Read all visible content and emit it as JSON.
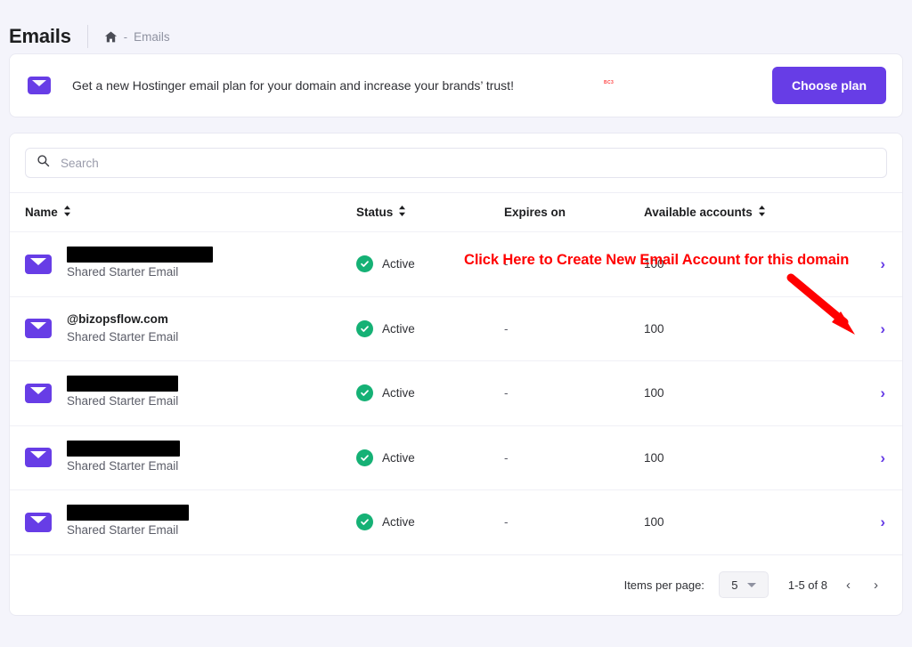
{
  "header": {
    "title": "Emails",
    "breadcrumb": {
      "home_icon": "home-icon",
      "separator": "-",
      "current": "Emails"
    }
  },
  "promo": {
    "icon": "envelope-icon",
    "text": "Get a new Hostinger email plan for your domain and increase your brands’ trust!",
    "small_tag": "BC3",
    "button_label": "Choose plan",
    "button_color": "#673de6"
  },
  "search": {
    "icon": "search-icon",
    "placeholder": "Search",
    "value": ""
  },
  "table": {
    "columns": [
      {
        "label": "Name",
        "sortable": true
      },
      {
        "label": "Status",
        "sortable": true
      },
      {
        "label": "Expires on",
        "sortable": false
      },
      {
        "label": "Available accounts",
        "sortable": true
      }
    ],
    "rows": [
      {
        "icon": "envelope-icon",
        "name": "",
        "redacted": true,
        "plan": "Shared Starter Email",
        "status": "Active",
        "status_color": "#15b175",
        "expires_on": "-",
        "available_accounts": "100",
        "chevron": "chevron-right-icon"
      },
      {
        "icon": "envelope-icon",
        "name": "@bizopsflow.com",
        "redacted": false,
        "plan": "Shared Starter Email",
        "status": "Active",
        "status_color": "#15b175",
        "expires_on": "-",
        "available_accounts": "100",
        "chevron": "chevron-right-icon"
      },
      {
        "icon": "envelope-icon",
        "name": "",
        "redacted": true,
        "plan": "Shared Starter Email",
        "status": "Active",
        "status_color": "#15b175",
        "expires_on": "-",
        "available_accounts": "100",
        "chevron": "chevron-right-icon"
      },
      {
        "icon": "envelope-icon",
        "name": "",
        "redacted": true,
        "plan": "Shared Starter Email",
        "status": "Active",
        "status_color": "#15b175",
        "expires_on": "-",
        "available_accounts": "100",
        "chevron": "chevron-right-icon"
      },
      {
        "icon": "envelope-icon",
        "name": "",
        "redacted": true,
        "plan": "Shared Starter Email",
        "status": "Active",
        "status_color": "#15b175",
        "expires_on": "-",
        "available_accounts": "100",
        "chevron": "chevron-right-icon"
      }
    ]
  },
  "pagination": {
    "items_per_page_label": "Items per page:",
    "items_per_page_value": "5",
    "range_text": "1-5 of 8",
    "prev_icon": "chevron-left-icon",
    "next_icon": "chevron-right-icon"
  },
  "annotation": {
    "text": "Click Here to Create New Email Account for this domain",
    "color": "#ff0000",
    "arrow": "red-arrow-pointing-down-right"
  }
}
